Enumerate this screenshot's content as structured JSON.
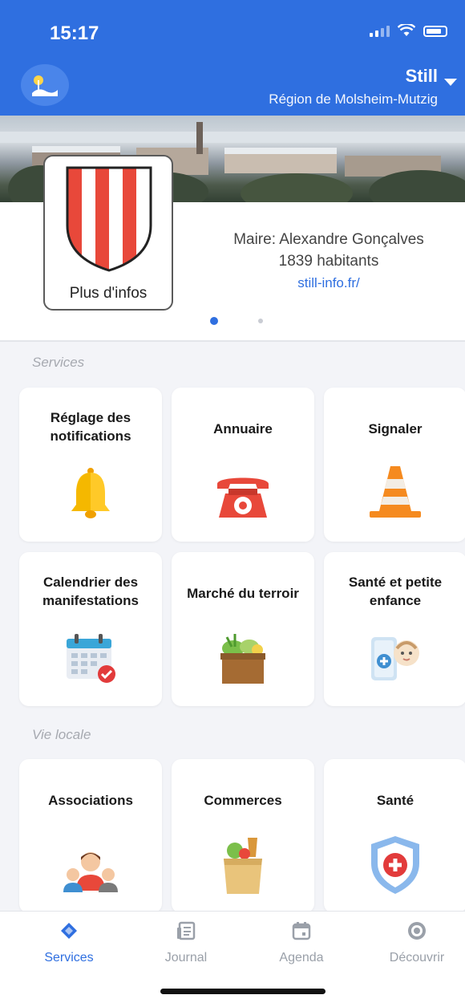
{
  "status": {
    "time": "15:17"
  },
  "header": {
    "city": "Still",
    "region": "Région de Molsheim-Mutzig"
  },
  "profile": {
    "more_info": "Plus d'infos",
    "mayor": "Maire: Alexandre Gonçalves",
    "population": "1839 habitants",
    "website": "still-info.fr/"
  },
  "sections": {
    "services": "Services",
    "local": "Vie locale"
  },
  "services_tiles": [
    {
      "title": "Réglage des notifications",
      "icon": "bell-icon"
    },
    {
      "title": "Annuaire",
      "icon": "telephone-icon"
    },
    {
      "title": "Signaler",
      "icon": "traffic-cone-icon"
    },
    {
      "title": "Calendrier des manifestations",
      "icon": "calendar-icon"
    },
    {
      "title": "Marché du terroir",
      "icon": "vegetable-basket-icon"
    },
    {
      "title": "Santé et petite enfance",
      "icon": "baby-care-icon"
    }
  ],
  "local_tiles": [
    {
      "title": "Associations",
      "icon": "people-group-icon"
    },
    {
      "title": "Commerces",
      "icon": "grocery-bag-icon"
    },
    {
      "title": "Santé",
      "icon": "health-shield-icon"
    }
  ],
  "tabs": [
    {
      "label": "Services",
      "icon": "services-icon",
      "active": true
    },
    {
      "label": "Journal",
      "icon": "newspaper-icon",
      "active": false
    },
    {
      "label": "Agenda",
      "icon": "calendar-tab-icon",
      "active": false
    },
    {
      "label": "Découvrir",
      "icon": "compass-icon",
      "active": false
    }
  ],
  "colors": {
    "primary": "#2f6fe0",
    "background": "#f3f4f8"
  }
}
